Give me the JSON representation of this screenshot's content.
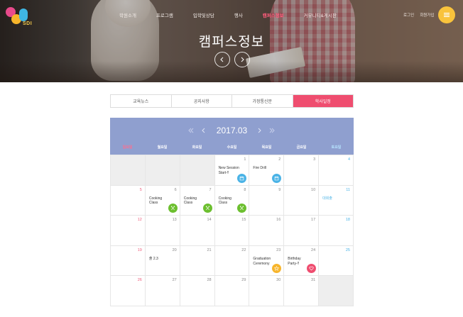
{
  "logo": {
    "text": "SDI"
  },
  "nav": {
    "items": [
      "학원소개",
      "프로그램",
      "입학및상담",
      "행사",
      "캠퍼스정보",
      "커뮤니티&게시판"
    ],
    "active_index": 4
  },
  "util": {
    "login": "로그인",
    "join": "회원가입"
  },
  "hero": {
    "title": "캠퍼스정보"
  },
  "tabs": [
    "교육뉴스",
    "공지사항",
    "가정통신문",
    "학사일정"
  ],
  "active_tab": 3,
  "calendar": {
    "month": "2017.03",
    "weekdays": [
      "일요일",
      "월요일",
      "화요일",
      "수요일",
      "목요일",
      "금요일",
      "토요일"
    ],
    "weeks": [
      [
        {
          "day": ""
        },
        {
          "day": ""
        },
        {
          "day": ""
        },
        {
          "day": "1",
          "event": "New Session\nStart-!!",
          "icon": "calendar-icon",
          "icon_color": "blue"
        },
        {
          "day": "2",
          "event": "Fire Drill",
          "icon": "calendar-icon",
          "icon_color": "blue"
        },
        {
          "day": "3"
        },
        {
          "day": "4"
        }
      ],
      [
        {
          "day": "5"
        },
        {
          "day": "6",
          "event": "Cooking\nClass",
          "icon": "utensils-icon",
          "icon_color": "green"
        },
        {
          "day": "7",
          "event": "Cooking\nClass",
          "icon": "utensils-icon",
          "icon_color": "green"
        },
        {
          "day": "8",
          "event": "Cooking\nClass",
          "icon": "utensils-icon",
          "icon_color": "green"
        },
        {
          "day": "9"
        },
        {
          "day": "10"
        },
        {
          "day": "11",
          "event": "대회출",
          "event_color": "blue"
        }
      ],
      [
        {
          "day": "12"
        },
        {
          "day": "13"
        },
        {
          "day": "14"
        },
        {
          "day": "15"
        },
        {
          "day": "16"
        },
        {
          "day": "17"
        },
        {
          "day": "18"
        }
      ],
      [
        {
          "day": "19"
        },
        {
          "day": "20",
          "event": "출 2.3"
        },
        {
          "day": "21"
        },
        {
          "day": "22"
        },
        {
          "day": "23",
          "event": "Graduation\nCeremony",
          "icon": "star-icon",
          "icon_color": "orange"
        },
        {
          "day": "24",
          "event": "Birthday\nParty-!!",
          "icon": "heart-icon",
          "icon_color": "pink"
        },
        {
          "day": "25"
        }
      ],
      [
        {
          "day": "26"
        },
        {
          "day": "27"
        },
        {
          "day": "28"
        },
        {
          "day": "29"
        },
        {
          "day": "30"
        },
        {
          "day": "31"
        },
        {
          "day": ""
        }
      ]
    ]
  },
  "colors": {
    "accent": "#ef4d6f",
    "calendar_header": "#8f9fcf",
    "sunday": "#ef5a7a",
    "saturday": "#4ab3e6",
    "menu_button": "#f9c33c"
  }
}
